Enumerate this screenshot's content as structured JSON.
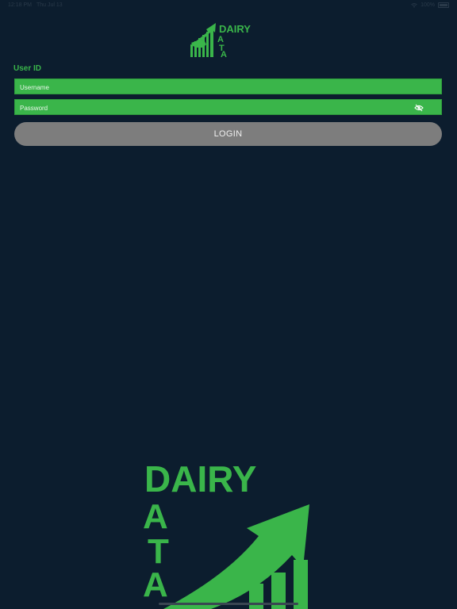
{
  "status_bar": {
    "time": "12:18 PM",
    "date": "Thu Jul 13",
    "battery": "100%"
  },
  "brand": {
    "word1": "DAIRY",
    "word2_letters": [
      "D",
      "A",
      "T",
      "A"
    ],
    "accent_color": "#3ab54a"
  },
  "form": {
    "user_id_label": "User ID",
    "username_placeholder": "Username",
    "password_placeholder": "Password",
    "login_label": "LOGIN"
  },
  "icons": {
    "password_toggle": "eye-slash-icon",
    "wifi": "wifi-icon",
    "battery": "battery-icon"
  },
  "colors": {
    "background": "#0c1d2e",
    "field_green": "#3ab54a",
    "button_gray": "#7d7d7d"
  }
}
